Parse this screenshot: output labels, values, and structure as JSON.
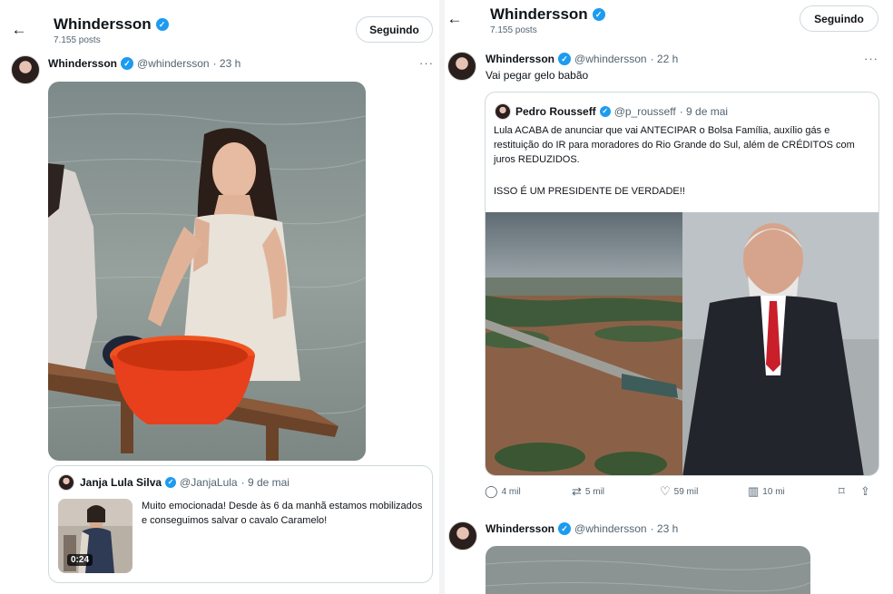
{
  "left": {
    "header": {
      "back_icon": "arrow-left-icon",
      "title": "Whindersson",
      "posts_count": "7.155 posts",
      "follow_label": "Seguindo"
    },
    "post": {
      "name": "Whindersson",
      "handle": "@whindersson",
      "time": "· 23 h",
      "more": "···",
      "video_scene": "woman-washing-clothes-in-flood-water",
      "quote": {
        "name": "Janja Lula Silva",
        "handle": "@JanjaLula",
        "time": "· 9 de mai",
        "text": "Muito emocionada! Desde às 6 da manhã estamos mobilizados e conseguimos salvar o cavalo Caramelo!",
        "duration": "0:24"
      }
    }
  },
  "right": {
    "header": {
      "back_icon": "arrow-left-icon",
      "title": "Whindersson",
      "posts_count": "7.155 posts",
      "follow_label": "Seguindo"
    },
    "post": {
      "name": "Whindersson",
      "handle": "@whindersson",
      "time": "· 22 h",
      "more": "···",
      "text": "Vai pegar gelo babão",
      "quote": {
        "name": "Pedro Rousseff",
        "handle": "@p_rousseff",
        "time": "· 9 de mai",
        "text": "Lula ACABA de anunciar que vai ANTECIPAR o Bolsa Família, auxílio gás e restituição do IR para moradores do Rio Grande do Sul, além de CRÉDITOS com juros REDUZIDOS.",
        "text2": "ISSO É UM PRESIDENTE DE VERDADE!!"
      },
      "actions": {
        "replies": "4 mil",
        "reposts": "5 mil",
        "likes": "59 mil",
        "views": "10 mi"
      }
    },
    "post2": {
      "name": "Whindersson",
      "handle": "@whindersson",
      "time": "· 23 h"
    }
  },
  "colors": {
    "verified": "#1d9bf0",
    "muted_text": "#536471",
    "border": "#cfd9de",
    "basin": "#e8401c",
    "flood_water": "#8a6147"
  }
}
